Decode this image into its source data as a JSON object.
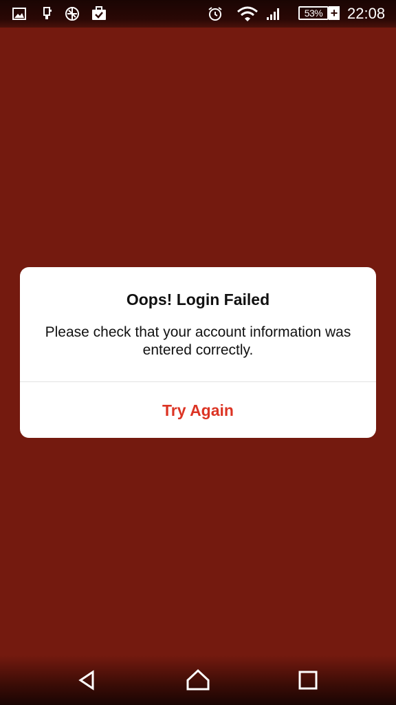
{
  "status_bar": {
    "icons": [
      "image-icon",
      "usb-debug-icon",
      "no-sync-icon",
      "briefcase-check-icon",
      "alarm-icon",
      "wifi-icon",
      "signal-icon"
    ],
    "battery_percent": "53%",
    "battery_charging_symbol": "+",
    "time": "22:08"
  },
  "dialog": {
    "title": "Oops! Login Failed",
    "message": "Please check that your account information was entered correctly.",
    "button_label": "Try Again"
  },
  "navigation_bar": {
    "buttons": [
      "back-icon",
      "home-icon",
      "recents-icon"
    ]
  },
  "colors": {
    "background": "#741a0f",
    "dialog_background": "#ffffff",
    "accent": "#dc3424"
  }
}
